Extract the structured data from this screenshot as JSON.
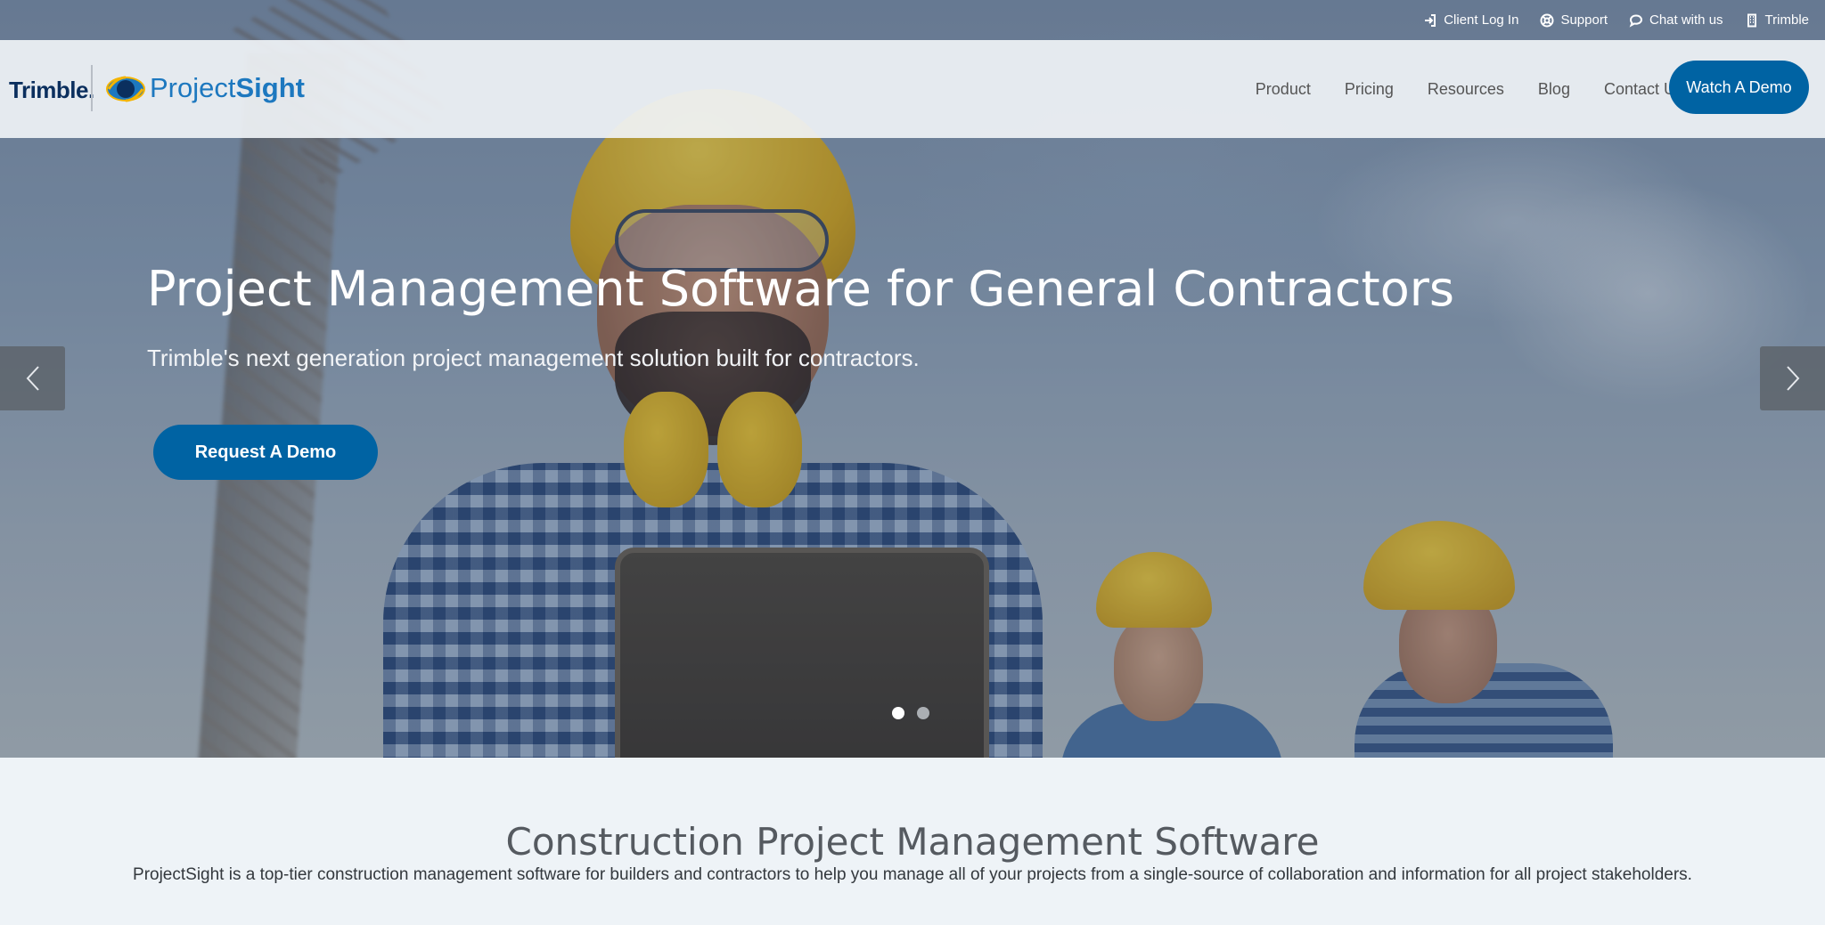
{
  "utility": {
    "client_login": "Client Log In",
    "support": "Support",
    "chat": "Chat with us",
    "trimble": "Trimble"
  },
  "brand": {
    "trimble_logo": "Trimble.",
    "product_logo_prefix": "Project",
    "product_logo_suffix": "Sight",
    "colors": {
      "primary_blue": "#0063a3",
      "logo_blue": "#1d78bf",
      "trimble_navy": "#0b2f5e",
      "logo_yellow": "#f4b400"
    }
  },
  "nav": {
    "items": [
      {
        "label": "Product"
      },
      {
        "label": "Pricing"
      },
      {
        "label": "Resources"
      },
      {
        "label": "Blog"
      },
      {
        "label": "Contact Us"
      }
    ],
    "cta": "Watch A Demo"
  },
  "hero": {
    "title": "Project Management Software for General Contractors",
    "subtitle": "Trimble's next generation project management solution built for contractors.",
    "cta": "Request A Demo",
    "carousel": {
      "slides": 2,
      "active": 1
    }
  },
  "intro": {
    "title": "Construction Project Management Software",
    "text": "ProjectSight is a top-tier construction management software for builders and contractors to help you manage all of your projects from a single-source of collaboration and information for all project stakeholders."
  }
}
